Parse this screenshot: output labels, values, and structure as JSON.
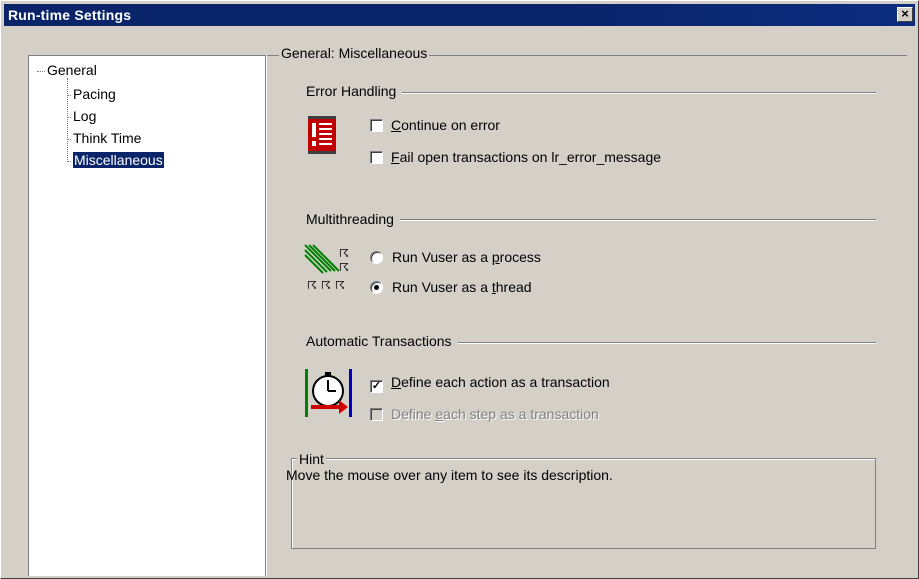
{
  "window": {
    "title": "Run-time Settings",
    "close_glyph": "×"
  },
  "tree": {
    "root": "General",
    "items": [
      {
        "label": "Pacing"
      },
      {
        "label": "Log"
      },
      {
        "label": "Think Time"
      },
      {
        "label": "Miscellaneous",
        "selected": true
      }
    ]
  },
  "panel": {
    "title": "General: Miscellaneous",
    "error_handling": {
      "title": "Error Handling",
      "icon": "error-sign-icon",
      "options": [
        {
          "label_first": "C",
          "label_rest": "ontinue on error",
          "checked": false
        },
        {
          "label_first": "F",
          "label_rest": "ail open transactions on lr_error_message",
          "checked": false
        }
      ]
    },
    "multithreading": {
      "title": "Multithreading",
      "icon": "threads-icon",
      "options": [
        {
          "label_pre": "Run Vuser as a ",
          "label_ul": "p",
          "label_post": "rocess",
          "selected": false
        },
        {
          "label_pre": "Run Vuser as a ",
          "label_ul": "t",
          "label_post": "hread",
          "selected": true
        }
      ]
    },
    "automatic_transactions": {
      "title": "Automatic Transactions",
      "icon": "stopwatch-icon",
      "options": [
        {
          "label_first": "D",
          "label_rest": "efine each action as a transaction",
          "checked": true,
          "check_glyph": "✓"
        },
        {
          "label_pre": "Define ",
          "label_ul": "e",
          "label_post": "ach step as a transaction",
          "checked": false,
          "disabled": true
        }
      ]
    },
    "hint": {
      "title": "Hint",
      "text": "Move the mouse over any item to see its description."
    }
  },
  "colors": {
    "titlebar": "#0a246a",
    "selection": "#0a246a",
    "face": "#d4d0c8"
  }
}
